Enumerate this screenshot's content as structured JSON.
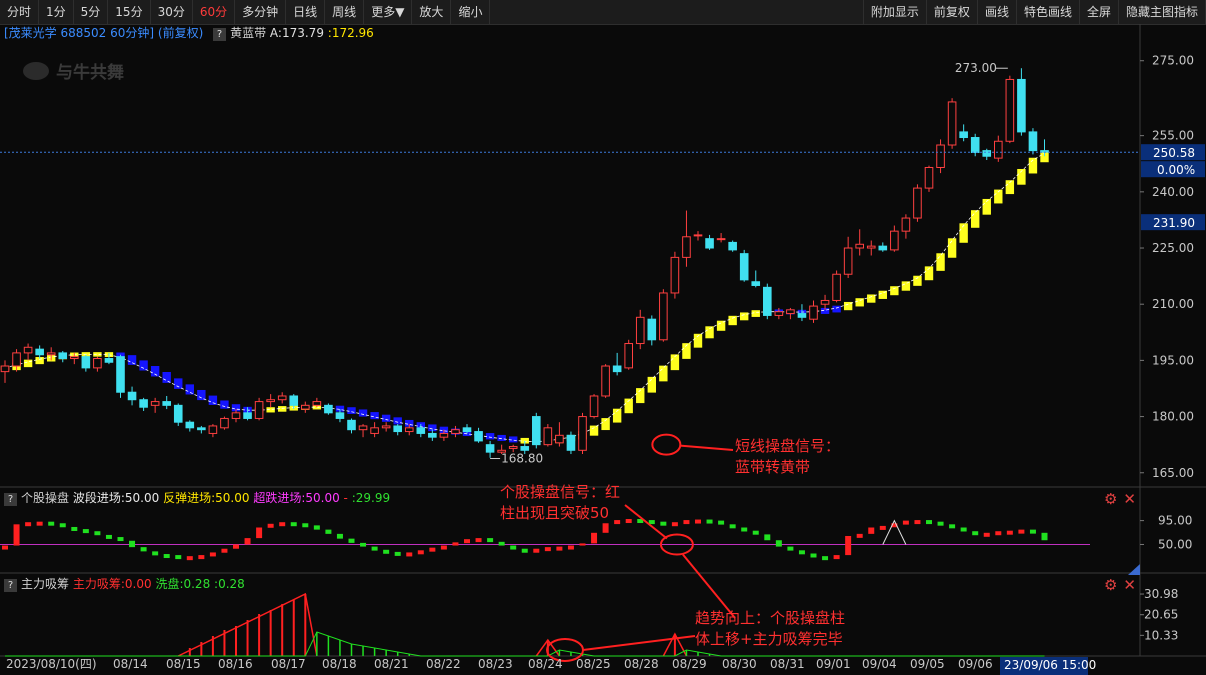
{
  "toolbar": {
    "left": [
      "分时",
      "1分",
      "5分",
      "15分",
      "30分",
      "60分",
      "多分钟",
      "日线",
      "周线",
      "更多▼",
      "放大",
      "缩小"
    ],
    "active": "60分",
    "right": [
      "附加显示",
      "前复权",
      "画线",
      "特色画线",
      "全屏",
      "隐藏主图指标"
    ]
  },
  "main": {
    "stock": "[茂莱光学 688502 60分钟] (前复权)",
    "indicator_name": "黄蓝带",
    "a_label": "A:173.79",
    "b_label": ":172.96",
    "watermark": "与牛共舞",
    "high_label": "273.00",
    "low_label": "168.80",
    "price_badge": "250.58",
    "pct_badge": "0.00%",
    "blue_badge": "231.90"
  },
  "sub1": {
    "name": "个股操盘",
    "f1": "波段进场:50.00",
    "f2": "反弹进场:50.00",
    "f3": "超跌进场:50.00",
    "f4": "-",
    "f5": ":29.99"
  },
  "sub2": {
    "name": "主力吸筹",
    "f1": "主力吸筹:0.00",
    "f2": "洗盘:0.28",
    "f3": ":0.28"
  },
  "xaxis": {
    "first": "2023/08/10(四)",
    "dates": [
      "08/14",
      "08/15",
      "08/16",
      "08/17",
      "08/18",
      "08/21",
      "08/22",
      "08/23",
      "08/24",
      "08/25",
      "08/28",
      "08/29",
      "08/30",
      "08/31",
      "09/01",
      "09/04",
      "09/05",
      "09/06"
    ],
    "cursor_time": "23/09/06 15:00"
  },
  "annotations": {
    "a1": "短线操盘信号：\n蓝带转黄带",
    "a2": "个股操盘信号：红\n柱出现且突破50",
    "a3": "趋势向上：个股操盘柱\n体上移+主力吸筹完毕"
  },
  "icons": {
    "help": "?",
    "settings": "gear-icon",
    "close": "close-icon"
  },
  "chart_data": [
    {
      "type": "candlestick",
      "title": "黄蓝带",
      "ylim": [
        162,
        280
      ],
      "yticks": [
        165.0,
        180.0,
        195.0,
        210.0,
        225.0,
        240.0,
        255.0,
        275.0
      ],
      "candles": [
        [
          192.0,
          195.0,
          189.0,
          193.5
        ],
        [
          193.5,
          198.0,
          192.0,
          197.0
        ],
        [
          197.0,
          199.5,
          195.0,
          198.5
        ],
        [
          198.0,
          199.0,
          195.5,
          196.5
        ],
        [
          196.5,
          198.5,
          195.0,
          197.0
        ],
        [
          197.0,
          197.5,
          194.5,
          195.5
        ],
        [
          195.5,
          197.0,
          194.0,
          196.0
        ],
        [
          196.0,
          196.5,
          192.0,
          193.0
        ],
        [
          193.0,
          196.0,
          192.0,
          195.5
        ],
        [
          195.5,
          197.0,
          194.0,
          194.5
        ],
        [
          196.0,
          196.5,
          185.0,
          186.5
        ],
        [
          186.5,
          188.0,
          183.0,
          184.5
        ],
        [
          184.5,
          185.0,
          181.5,
          182.5
        ],
        [
          183.0,
          185.0,
          181.0,
          184.0
        ],
        [
          184.0,
          185.5,
          182.0,
          183.0
        ],
        [
          183.0,
          183.5,
          177.5,
          178.5
        ],
        [
          178.5,
          179.0,
          176.0,
          177.0
        ],
        [
          177.0,
          177.5,
          175.5,
          176.5
        ],
        [
          175.5,
          178.0,
          174.5,
          177.5
        ],
        [
          177.0,
          180.0,
          176.5,
          179.5
        ],
        [
          179.5,
          182.0,
          178.5,
          181.0
        ],
        [
          181.0,
          182.5,
          179.0,
          179.5
        ],
        [
          179.5,
          185.0,
          179.0,
          184.0
        ],
        [
          184.0,
          186.0,
          182.5,
          184.5
        ],
        [
          184.5,
          186.5,
          183.5,
          185.5
        ],
        [
          185.5,
          186.0,
          182.0,
          183.0
        ],
        [
          182.0,
          184.0,
          181.0,
          183.0
        ],
        [
          183.0,
          185.0,
          182.5,
          184.0
        ],
        [
          183.0,
          183.5,
          180.5,
          181.0
        ],
        [
          181.0,
          182.0,
          178.5,
          179.5
        ],
        [
          179.0,
          179.5,
          175.5,
          176.5
        ],
        [
          176.5,
          178.0,
          174.5,
          177.5
        ],
        [
          175.5,
          178.5,
          174.5,
          177.0
        ],
        [
          177.0,
          178.5,
          176.0,
          177.5
        ],
        [
          177.5,
          178.0,
          175.0,
          176.0
        ],
        [
          176.0,
          178.0,
          175.0,
          177.0
        ],
        [
          177.0,
          178.0,
          174.5,
          175.5
        ],
        [
          175.5,
          176.5,
          173.5,
          174.5
        ],
        [
          174.5,
          176.5,
          173.5,
          175.5
        ],
        [
          175.5,
          177.5,
          174.5,
          176.5
        ],
        [
          177.0,
          178.0,
          175.5,
          176.0
        ],
        [
          176.0,
          177.0,
          173.0,
          173.5
        ],
        [
          172.5,
          173.5,
          169.0,
          170.5
        ],
        [
          170.5,
          172.5,
          170.0,
          171.0
        ],
        [
          171.5,
          172.5,
          170.5,
          172.0
        ],
        [
          172.0,
          173.5,
          170.0,
          171.0
        ],
        [
          180.0,
          181.0,
          171.5,
          172.5
        ],
        [
          172.5,
          178.0,
          172.0,
          177.0
        ],
        [
          173.0,
          178.5,
          172.0,
          175.0
        ],
        [
          175.0,
          176.0,
          170.0,
          171.0
        ],
        [
          171.0,
          181.0,
          170.0,
          180.0
        ],
        [
          180.0,
          186.0,
          179.5,
          185.5
        ],
        [
          185.5,
          194.0,
          185.0,
          193.5
        ],
        [
          193.5,
          197.0,
          191.0,
          192.0
        ],
        [
          193.0,
          200.5,
          192.5,
          199.5
        ],
        [
          199.5,
          208.5,
          198.0,
          206.5
        ],
        [
          206.0,
          207.0,
          199.0,
          200.5
        ],
        [
          200.5,
          214.0,
          200.0,
          213.0
        ],
        [
          213.0,
          224.0,
          211.5,
          222.5
        ],
        [
          222.5,
          235.0,
          220.0,
          228.0
        ],
        [
          228.5,
          229.5,
          227.0,
          228.5
        ],
        [
          227.5,
          228.5,
          224.5,
          225.0
        ],
        [
          227.5,
          229.0,
          226.5,
          227.5
        ],
        [
          226.5,
          227.0,
          224.0,
          224.5
        ],
        [
          223.5,
          224.5,
          216.0,
          216.5
        ],
        [
          216.0,
          219.0,
          214.5,
          215.0
        ],
        [
          214.5,
          215.5,
          206.0,
          207.0
        ],
        [
          207.0,
          209.0,
          206.0,
          208.0
        ],
        [
          207.5,
          209.0,
          206.0,
          208.5
        ],
        [
          207.5,
          210.0,
          205.5,
          206.5
        ],
        [
          206.0,
          211.0,
          205.0,
          209.5
        ],
        [
          210.0,
          212.5,
          208.5,
          211.0
        ],
        [
          211.0,
          219.0,
          210.5,
          218.0
        ],
        [
          218.0,
          228.0,
          217.0,
          225.0
        ],
        [
          225.0,
          230.0,
          223.0,
          226.0
        ],
        [
          225.0,
          227.0,
          223.0,
          225.5
        ],
        [
          225.5,
          226.5,
          224.0,
          224.5
        ],
        [
          224.5,
          231.0,
          224.0,
          229.5
        ],
        [
          229.5,
          234.0,
          227.5,
          233.0
        ],
        [
          233.0,
          242.0,
          232.0,
          241.0
        ],
        [
          241.0,
          247.0,
          240.0,
          246.5
        ],
        [
          246.5,
          254.0,
          245.0,
          252.5
        ],
        [
          252.5,
          265.0,
          251.5,
          264.0
        ],
        [
          256.0,
          258.0,
          253.5,
          254.5
        ],
        [
          254.5,
          255.5,
          249.5,
          250.5
        ],
        [
          251.0,
          251.5,
          248.5,
          249.5
        ],
        [
          249.0,
          255.0,
          248.0,
          253.5
        ],
        [
          253.5,
          271.0,
          253.0,
          270.0
        ],
        [
          270.0,
          273.0,
          255.0,
          256.0
        ],
        [
          256.0,
          257.0,
          250.0,
          251.0
        ],
        [
          251.0,
          254.0,
          249.5,
          250.6
        ]
      ],
      "yellow_blue_band": {
        "values": [
          193.0,
          193.8,
          194.6,
          195.3,
          195.9,
          196.3,
          196.5,
          196.6,
          196.6,
          196.5,
          195.8,
          194.4,
          192.9,
          191.3,
          189.6,
          188.0,
          186.5,
          185.0,
          183.7,
          182.7,
          182.0,
          181.7,
          181.7,
          181.9,
          182.2,
          182.4,
          182.5,
          182.5,
          182.3,
          181.9,
          181.3,
          180.6,
          179.9,
          179.2,
          178.5,
          177.9,
          177.3,
          176.7,
          176.2,
          175.8,
          175.4,
          175.0,
          174.5,
          174.1,
          173.7,
          173.4,
          173.3,
          173.5,
          174.0,
          174.5,
          175.5,
          177.0,
          179.0,
          181.5,
          184.2,
          187.0,
          190.0,
          193.0,
          196.0,
          199.0,
          201.5,
          203.5,
          205.0,
          206.3,
          207.2,
          207.8,
          208.0,
          208.0,
          207.9,
          207.9,
          208.0,
          208.4,
          209.0,
          210.0,
          211.0,
          212.0,
          213.0,
          214.2,
          215.5,
          217.0,
          219.5,
          223.0,
          227.0,
          231.0,
          234.5,
          237.5,
          240.0,
          242.5,
          245.5,
          248.5,
          250.3
        ],
        "colors": "yellow 0-9, blue 10-21, yellow 22-27, blue 28-44, yellow 45-65, blue 66-72, yellow 73-90"
      }
    },
    {
      "type": "bar",
      "title": "个股操盘",
      "ylim": [
        0,
        115
      ],
      "yticks": [
        50.0,
        95.0
      ],
      "baseline": 50,
      "values": [
        48,
        88,
        92,
        93,
        90,
        83,
        79,
        75,
        68,
        64,
        57,
        45,
        37,
        32,
        30,
        28,
        28,
        30,
        35,
        42,
        50,
        62,
        82,
        89,
        92,
        90,
        86,
        78,
        70,
        61,
        53,
        46,
        40,
        36,
        33,
        35,
        39,
        44,
        48,
        54,
        60,
        62,
        55,
        48,
        42,
        40,
        42,
        45,
        46,
        48,
        52,
        72,
        90,
        96,
        98,
        96,
        93,
        90,
        92,
        96,
        97,
        95,
        88,
        82,
        76,
        69,
        58,
        46,
        39,
        33,
        28,
        26,
        30,
        66,
        70,
        82,
        85,
        90,
        95,
        96,
        93,
        88,
        82,
        75,
        70,
        72,
        75,
        76,
        78,
        72,
        58
      ]
    },
    {
      "type": "bar",
      "title": "主力吸筹",
      "ylim": [
        0,
        32
      ],
      "yticks": [
        10.33,
        20.65,
        30.98
      ],
      "red_bars": [
        0,
        0,
        0,
        0,
        0,
        0,
        0,
        0,
        0,
        0,
        0,
        0,
        0,
        0,
        0,
        0,
        4,
        7,
        10,
        13,
        15,
        18,
        21,
        23,
        26,
        28,
        31,
        0,
        0,
        0,
        0,
        0,
        0,
        0,
        0,
        0,
        0,
        0,
        0,
        0,
        0,
        0,
        0,
        0,
        0,
        0,
        0,
        8,
        0,
        0,
        0,
        0,
        0,
        0,
        0,
        0,
        0,
        0,
        11,
        0,
        0,
        0,
        0,
        0,
        0,
        0,
        0,
        0,
        0,
        0,
        0,
        0,
        0,
        0,
        0,
        0,
        0,
        0,
        0,
        0,
        0,
        0,
        0,
        0,
        0,
        0,
        0,
        0,
        0,
        0,
        0
      ],
      "green_line": [
        0,
        0,
        0,
        0,
        0,
        0,
        0,
        0,
        0,
        0,
        0,
        0,
        0,
        0,
        0,
        0,
        0,
        0,
        0,
        0,
        0,
        0,
        0,
        0,
        0,
        0,
        0,
        12,
        10,
        8,
        6,
        5,
        4,
        3,
        2,
        1,
        0,
        0,
        0,
        0,
        0,
        0,
        0,
        0,
        0,
        0,
        0,
        0,
        3,
        2,
        1,
        0,
        0,
        0,
        0,
        0,
        0,
        0,
        0,
        3,
        2,
        1,
        0,
        0,
        0,
        0,
        0,
        0,
        0,
        0,
        0,
        0,
        0,
        0,
        0,
        0,
        0,
        0,
        0,
        0,
        0,
        0,
        0,
        0,
        0,
        0,
        0,
        0,
        0,
        0,
        0
      ]
    }
  ]
}
